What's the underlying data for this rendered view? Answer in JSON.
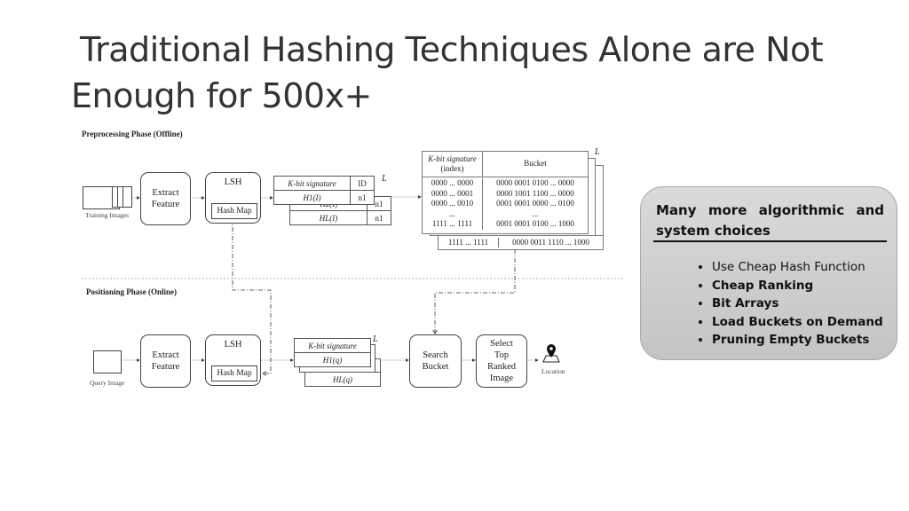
{
  "title": {
    "line1": "Traditional Hashing Techniques Alone are Not",
    "line2": "Enough for 500x+"
  },
  "diagram": {
    "offline": {
      "phase_label": "Preprocessing Phase (Offline)",
      "input_label": "Training Images",
      "extract": [
        "Extract",
        "Feature"
      ],
      "lsh": "LSH",
      "hash_map": "Hash Map",
      "sig_header": "K-bit signature",
      "id_header": "ID",
      "rows": [
        [
          "H1(I)",
          "n1"
        ],
        [
          "H2(I)",
          "n1"
        ],
        [
          "HL(I)",
          "n1"
        ]
      ],
      "L": "L",
      "bucket_table": {
        "key_header": [
          "K-bit signature",
          "(index)"
        ],
        "bucket_header": "Bucket",
        "keys": [
          "0000 ... 0000",
          "0000 ... 0001",
          "0000 ... 0010",
          "...",
          "1111 ... 1111"
        ],
        "buckets": [
          "0000 0001 0100 ... 0000",
          "0000 1001 1100 ... 0000",
          "0001 0001 0000 ... 0100",
          "...",
          "0001 0001 0100 ... 1000"
        ],
        "highlight_color": "#d62020",
        "back_last_key": "1111 ... 1111",
        "back_last_bucket": "0000 0011 1110 ... 1000"
      }
    },
    "online": {
      "phase_label": "Positioning Phase (Online)",
      "input_label": "Query Image",
      "extract": [
        "Extract",
        "Feature"
      ],
      "lsh": "LSH",
      "hash_map": "Hash Map",
      "sig_header": "K-bit signature",
      "rows": [
        "H1(q)",
        "HL(q)"
      ],
      "L": "L",
      "search": [
        "Search",
        "Bucket"
      ],
      "select": [
        "Select",
        "Top",
        "Ranked",
        "Image"
      ],
      "output_label": "Location",
      "output_icon": "location-pin-icon"
    }
  },
  "panel": {
    "heading": "Many more algorithmic and system choices",
    "items": [
      {
        "text": "Use Cheap Hash Function",
        "bold": false
      },
      {
        "text": "Cheap Ranking",
        "bold": true
      },
      {
        "text": "Bit Arrays",
        "bold": true
      },
      {
        "text": "Load Buckets on Demand",
        "bold": true
      },
      {
        "text": "Pruning Empty Buckets",
        "bold": true
      }
    ]
  }
}
